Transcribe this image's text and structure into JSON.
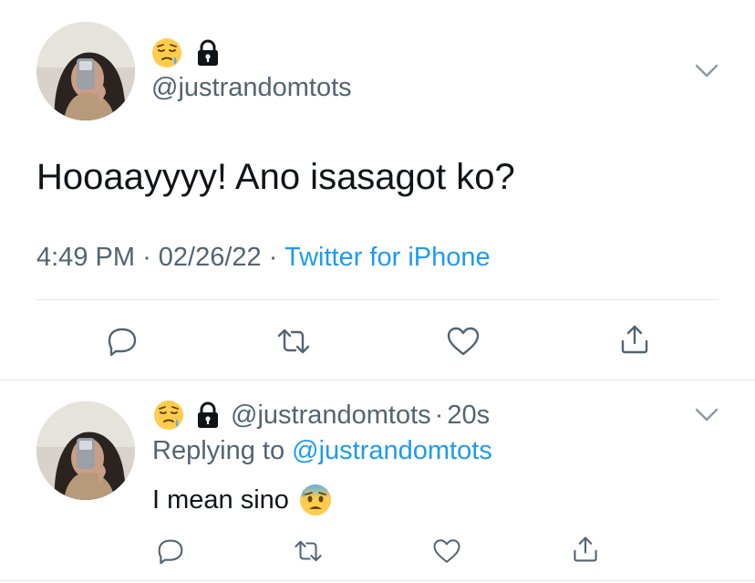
{
  "main_tweet": {
    "emoji_name": "sleepy-face-emoji",
    "lock_icon": "lock-icon",
    "handle": "@justrandomtots",
    "text": "Hooaayyyy! Ano isasagot ko?",
    "time": "4:49 PM",
    "date": "02/26/22",
    "separator": "·",
    "source": "Twitter for iPhone",
    "actions": [
      "reply-icon",
      "retweet-icon",
      "like-icon",
      "share-icon"
    ]
  },
  "reply_tweet": {
    "emoji_name": "sleepy-face-emoji",
    "lock_icon": "lock-icon",
    "handle": "@justrandomtots",
    "separator": "·",
    "age": "20s",
    "replying_prefix": "Replying to",
    "replying_to": "@justrandomtots",
    "text": "I mean sino",
    "text_emoji": "anxious-face-with-sweat-emoji",
    "actions": [
      "reply-icon",
      "retweet-icon",
      "like-icon",
      "share-icon"
    ]
  },
  "colors": {
    "text_primary": "#0f1419",
    "text_secondary": "#536471",
    "link": "#1d9bf0",
    "divider": "#e1e4e8",
    "icon": "#536471"
  }
}
